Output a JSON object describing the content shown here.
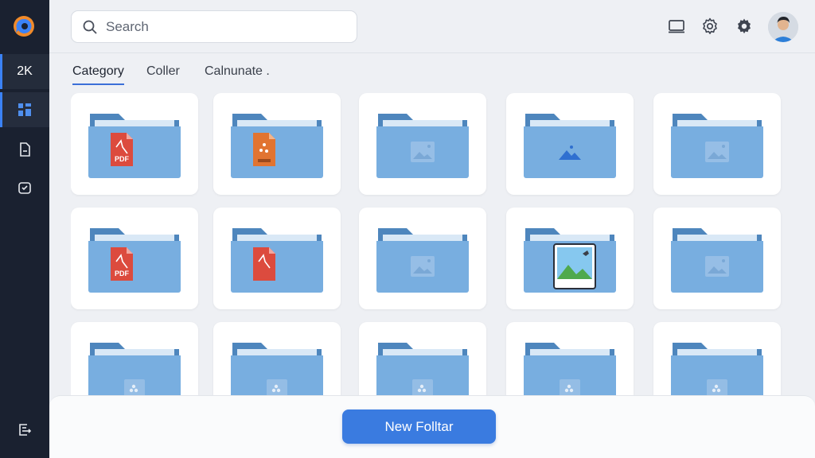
{
  "sidebar": {
    "logo_icon": "app-logo-icon",
    "items": [
      {
        "label": "2K",
        "icon": ""
      },
      {
        "label": "",
        "icon": "grid-icon"
      },
      {
        "label": "",
        "icon": "document-icon"
      },
      {
        "label": "",
        "icon": "inbox-check-icon"
      },
      {
        "label": "",
        "icon": "exit-icon"
      }
    ]
  },
  "header": {
    "search_placeholder": "Search",
    "icons": [
      "screen-icon",
      "gear-icon",
      "settings-icon"
    ],
    "avatar": "user-avatar"
  },
  "tabs": [
    {
      "label": "Category",
      "active": true
    },
    {
      "label": "Coller",
      "active": false
    },
    {
      "label": "Calnunate .",
      "active": false
    }
  ],
  "folders": [
    {
      "badge": "pdf-red",
      "text": "PDF"
    },
    {
      "badge": "archive-orange",
      "text": "ZIP"
    },
    {
      "badge": "image-faded",
      "text": ""
    },
    {
      "badge": "mountain-blue",
      "text": ""
    },
    {
      "badge": "image-faded",
      "text": ""
    },
    {
      "badge": "pdf-red",
      "text": "PDF"
    },
    {
      "badge": "pdf-red",
      "text": ""
    },
    {
      "badge": "image-faded",
      "text": ""
    },
    {
      "badge": "image-color",
      "text": ""
    },
    {
      "badge": "image-faded",
      "text": ""
    },
    {
      "badge": "dots-faded",
      "text": ""
    },
    {
      "badge": "dots-faded",
      "text": ""
    },
    {
      "badge": "dots-faded",
      "text": ""
    },
    {
      "badge": "dots-faded",
      "text": ""
    },
    {
      "badge": "dots-faded",
      "text": ""
    }
  ],
  "footer": {
    "new_button_label": "New Folltar"
  },
  "colors": {
    "accent": "#3a7be0",
    "folder_body": "#78aee0",
    "folder_back": "#4e86bd",
    "sidebar": "#1a2130"
  }
}
